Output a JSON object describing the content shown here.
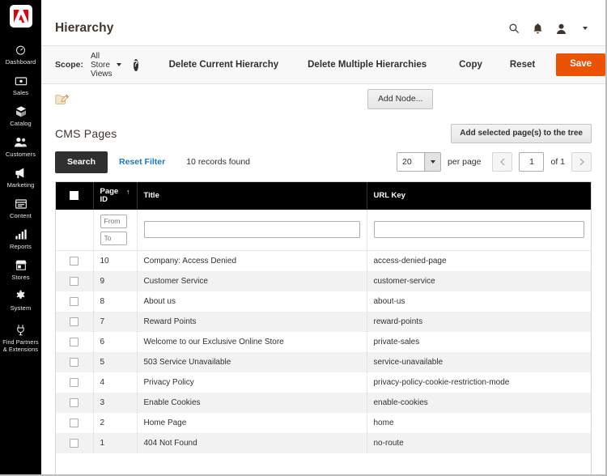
{
  "sidebar": {
    "logo": "adobe-logo",
    "items": [
      {
        "label": "Dashboard",
        "icon": "dashboard-icon"
      },
      {
        "label": "Sales",
        "icon": "sales-icon"
      },
      {
        "label": "Catalog",
        "icon": "catalog-icon"
      },
      {
        "label": "Customers",
        "icon": "customers-icon"
      },
      {
        "label": "Marketing",
        "icon": "marketing-icon"
      },
      {
        "label": "Content",
        "icon": "content-icon"
      },
      {
        "label": "Reports",
        "icon": "reports-icon"
      },
      {
        "label": "Stores",
        "icon": "stores-icon"
      },
      {
        "label": "System",
        "icon": "system-icon"
      },
      {
        "label": "Find Partners\n& Extensions",
        "label_line1": "Find Partners",
        "label_line2": "& Extensions",
        "icon": "partners-icon"
      }
    ]
  },
  "header": {
    "title": "Hierarchy",
    "icons": [
      "search-icon",
      "notifications-bell-icon",
      "user-account-icon",
      "chevron-down-icon"
    ]
  },
  "toolbar": {
    "scope_label": "Scope:",
    "scope_value": "All Store Views",
    "help_label": "?",
    "delete_current": "Delete Current Hierarchy",
    "delete_multiple": "Delete Multiple Hierarchies",
    "copy": "Copy",
    "reset": "Reset",
    "save": "Save",
    "save_color": "#eb5202"
  },
  "tree": {
    "add_node": "Add Node...",
    "node_icon": "folder-edit-icon"
  },
  "cms": {
    "title": "CMS Pages",
    "add_selected": "Add selected page(s) to the tree"
  },
  "grid_bar": {
    "search": "Search",
    "reset_filter": "Reset Filter",
    "records_found": "10 records found",
    "per_page_value": "20",
    "per_page_label": "per page",
    "page_value": "1",
    "of_label": "of 1",
    "prev_icon": "chevron-left-icon",
    "next_icon": "chevron-right-icon"
  },
  "table": {
    "columns": [
      "",
      "Page ID",
      "Title",
      "URL Key"
    ],
    "sort_column": "Page ID",
    "sort_direction": "asc",
    "sort_glyph": "↑",
    "filters": {
      "id_from_placeholder": "From",
      "id_to_placeholder": "To",
      "id_from_value": "",
      "id_to_value": "",
      "title_value": "",
      "url_key_value": ""
    },
    "rows": [
      {
        "page_id": "10",
        "title": "Company: Access Denied",
        "url_key": "access-denied-page"
      },
      {
        "page_id": "9",
        "title": "Customer Service",
        "url_key": "customer-service"
      },
      {
        "page_id": "8",
        "title": "About us",
        "url_key": "about-us"
      },
      {
        "page_id": "7",
        "title": "Reward Points",
        "url_key": "reward-points"
      },
      {
        "page_id": "6",
        "title": "Welcome to our Exclusive Online Store",
        "url_key": "private-sales"
      },
      {
        "page_id": "5",
        "title": "503 Service Unavailable",
        "url_key": "service-unavailable"
      },
      {
        "page_id": "4",
        "title": "Privacy Policy",
        "url_key": "privacy-policy-cookie-restriction-mode"
      },
      {
        "page_id": "3",
        "title": "Enable Cookies",
        "url_key": "enable-cookies"
      },
      {
        "page_id": "2",
        "title": "Home Page",
        "url_key": "home"
      },
      {
        "page_id": "1",
        "title": "404 Not Found",
        "url_key": "no-route"
      }
    ]
  }
}
